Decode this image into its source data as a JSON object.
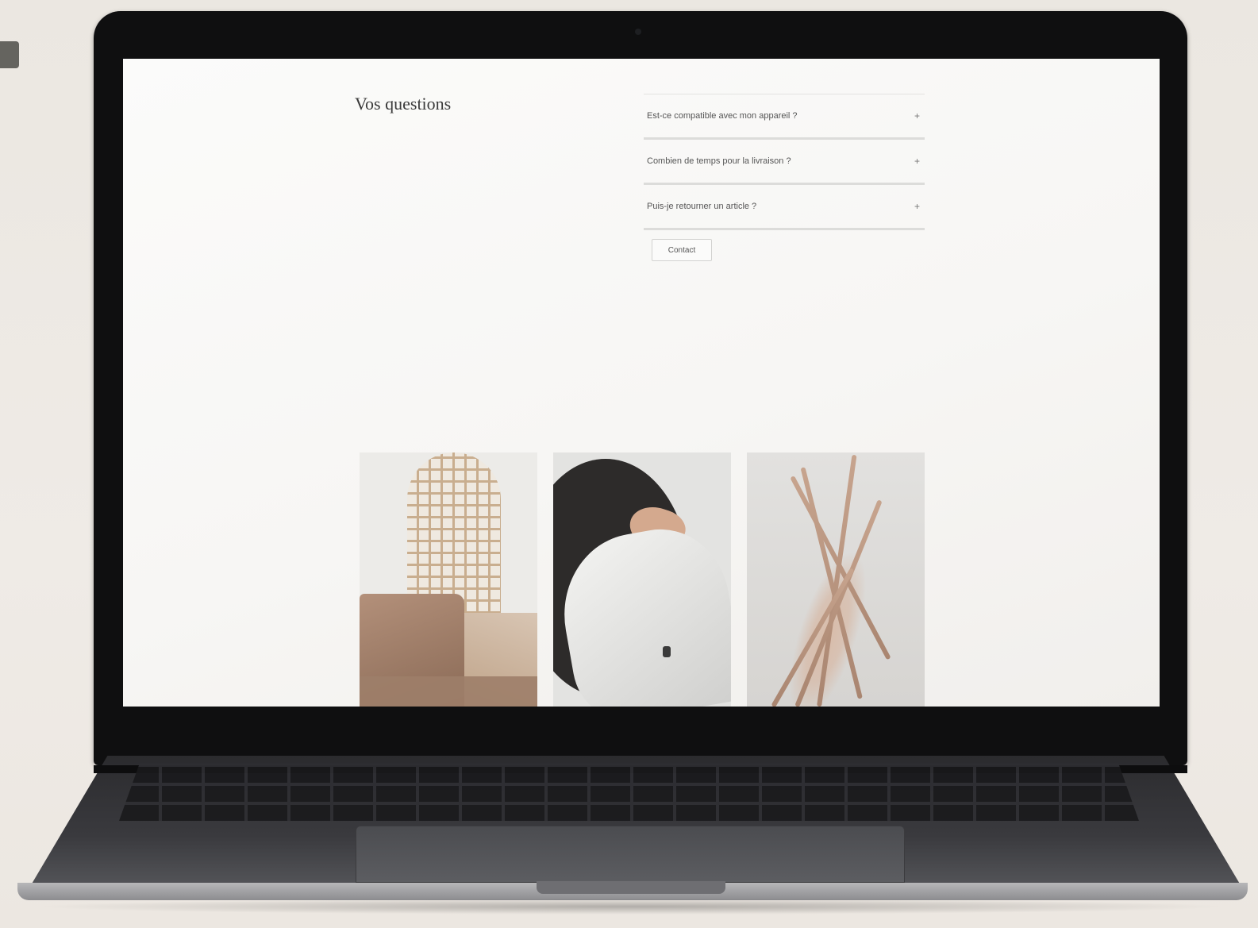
{
  "faq": {
    "title": "Vos questions",
    "items": [
      {
        "question": "Est-ce compatible avec mon appareil ?",
        "icon": "plus-icon",
        "expand": "+"
      },
      {
        "question": "Combien de temps pour la livraison ?",
        "icon": "plus-icon",
        "expand": "+"
      },
      {
        "question": "Puis-je retourner un article ?",
        "icon": "plus-icon",
        "expand": "+"
      }
    ],
    "contact_label": "Contact"
  },
  "gallery": {
    "photos": [
      {
        "name": "woven-headboard-cushions-photo"
      },
      {
        "name": "white-cloth-dark-arch-photo"
      },
      {
        "name": "pampas-grass-photo"
      }
    ]
  },
  "colors": {
    "screen_bg": "#f8f7f5",
    "bezel": "#0f0f10",
    "divider": "#dcdcda"
  }
}
